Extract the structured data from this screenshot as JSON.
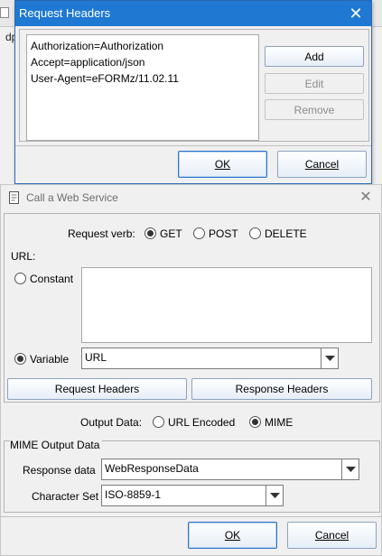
{
  "background": {
    "app_text": "dp"
  },
  "request_headers_dialog": {
    "title": "Request Headers",
    "headers": [
      "Authorization=Authorization",
      "Accept=application/json",
      "User-Agent=eFORMz/11.02.11"
    ],
    "add_label": "Add",
    "edit_label": "Edit",
    "remove_label": "Remove",
    "ok_label": "OK",
    "cancel_label": "Cancel"
  },
  "web_service_dialog": {
    "title": "Call a Web Service",
    "request_verb_label": "Request verb:",
    "verbs": {
      "get": "GET",
      "post": "POST",
      "delete": "DELETE"
    },
    "selected_verb": "GET",
    "url_label": "URL:",
    "constant_label": "Constant",
    "constant_value": "",
    "variable_label": "Variable",
    "variable_value": "URL",
    "url_source_selected": "Variable",
    "request_headers_button": "Request Headers",
    "response_headers_button": "Response Headers",
    "output_data_label": "Output Data:",
    "output_options": {
      "url_encoded": "URL Encoded",
      "mime": "MIME"
    },
    "selected_output": "MIME",
    "mime_group_label": "MIME Output Data",
    "response_data_label": "Response data",
    "response_data_value": "WebResponseData",
    "character_set_label": "Character Set",
    "character_set_value": "ISO-8859-1",
    "ok_label": "OK",
    "cancel_label": "Cancel"
  },
  "colors": {
    "title_bar_active": "#1f78d1",
    "dialog_background": "#f0f0f0",
    "button_border": "#8ea3bd"
  }
}
